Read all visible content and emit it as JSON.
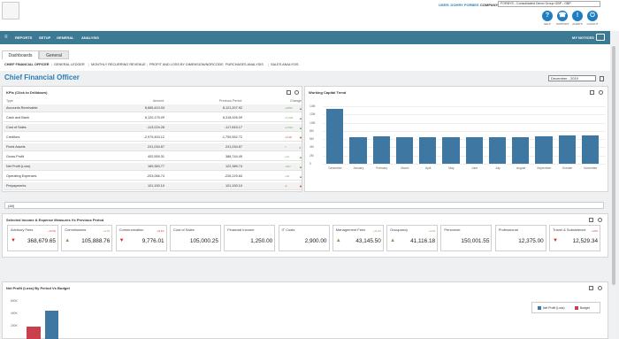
{
  "header": {
    "user": "USER: DOHRY FORBES",
    "company_label": "COMPANY:",
    "company_value": "FORBYS - Consolidated Demo Group GBP - GBP",
    "tools": [
      {
        "label": "HELP",
        "icon": "?"
      },
      {
        "label": "SUPPORT",
        "icon": "☎"
      },
      {
        "label": "ALERTS",
        "icon": "!"
      },
      {
        "label": "LOGOUT",
        "icon": "⏻"
      }
    ]
  },
  "nav": {
    "items": [
      "REPORTS",
      "SETUP",
      "GENERAL",
      "ANALYSIS"
    ],
    "notices": "MY NOTICES"
  },
  "subnav": [
    "CHIEF FINANCIAL OFFICER",
    "GENERAL LEDGER",
    "MONTHLY RECURRING REVENUE",
    "PROFIT AND LOSS BY DIMENSION/NORCODE",
    "PURCHASES ANALYSIS",
    "SALES ANALYSIS"
  ],
  "tabs": [
    "Dashboards",
    "General"
  ],
  "page_title": "Chief Financial Officer",
  "period": "December - 2019",
  "kpi": {
    "title": "KPIs (Click to Drilldown)",
    "cols": [
      "Type",
      "Amount",
      "Previous Period",
      "Change"
    ],
    "rows": [
      {
        "type": "Accounts Receivable",
        "amount": "8,665,410.04",
        "prev": "8,121,207.92",
        "change": "+2050",
        "dir": "up"
      },
      {
        "type": "Cash and Bank",
        "amount": "6,120,175.09",
        "prev": "6,318,926.09",
        "change": "+1,226",
        "dir": "up"
      },
      {
        "type": "Cost of Sales",
        "amount": "-113,224.28",
        "prev": "-117,843.17",
        "change": "+4,614",
        "dir": "up"
      },
      {
        "type": "Creditors",
        "amount": "-2,979,453.12",
        "prev": "-1,759,552.72",
        "change": "-1719",
        "dir": "down"
      },
      {
        "type": "Fixed Assets",
        "amount": "241,034.67",
        "prev": "241,034.67",
        "change": "0",
        "dir": "neutral"
      },
      {
        "type": "Gross Profit",
        "amount": "402,559.31",
        "prev": "388,744.49",
        "change": "+14",
        "dir": "up"
      },
      {
        "type": "Net Profit (Loss)",
        "amount": "189,383.77",
        "prev": "122,389.74",
        "change": "+107",
        "dir": "up"
      },
      {
        "type": "Operating Expenses",
        "amount": "-203,066.74",
        "prev": "-226,229.84",
        "change": "+23",
        "dir": "up"
      },
      {
        "type": "Prepayments",
        "amount": "101,150.10",
        "prev": "101,150.10",
        "change": "-1",
        "dir": "down"
      }
    ]
  },
  "wc": {
    "title": "Working Capital Trend",
    "months": [
      "December",
      "January",
      "February",
      "March",
      "April",
      "May",
      "June",
      "July",
      "August",
      "September",
      "October",
      "November"
    ],
    "yticks": [
      "0",
      "2M",
      "4M",
      "6M",
      "8M",
      "10M",
      "12M",
      "14M"
    ]
  },
  "chart_data": {
    "type": "bar",
    "categories": [
      "December",
      "January",
      "February",
      "March",
      "April",
      "May",
      "June",
      "July",
      "August",
      "September",
      "October",
      "November"
    ],
    "values": [
      13.3,
      6.5,
      6.6,
      6.4,
      6.5,
      6.4,
      6.5,
      6.4,
      6.5,
      6.6,
      6.8,
      6.9
    ],
    "ylim": [
      0,
      14
    ]
  },
  "kpi_dropdown": "(All)",
  "income": {
    "title": "Selected Income & Expense Measures Vs Previous Period",
    "cards": [
      {
        "name": "Advisory Fees",
        "value": "368,679.65",
        "pct": "+10.5%",
        "dir": "down"
      },
      {
        "name": "Commissions",
        "value": "105,888.76",
        "pct": "+4.7%",
        "dir": "up"
      },
      {
        "name": "Communication",
        "value": "9,776.01",
        "pct": "-24.4%",
        "dir": "down"
      },
      {
        "name": "Cost of Sales",
        "value": "105,000.25",
        "pct": "",
        "dir": "none"
      },
      {
        "name": "Financial Income",
        "value": "1,250.00",
        "pct": "",
        "dir": "none"
      },
      {
        "name": "IT Costs",
        "value": "2,900.00",
        "pct": "",
        "dir": "none"
      },
      {
        "name": "Management Fees",
        "value": "43,145.50",
        "pct": "+14.3%",
        "dir": "up"
      },
      {
        "name": "Occupancy",
        "value": "41,116.18",
        "pct": "+4.4%",
        "dir": "up"
      },
      {
        "name": "Personnel",
        "value": "150,001.55",
        "pct": "",
        "dir": "none"
      },
      {
        "name": "Professional",
        "value": "12,375.00",
        "pct": "",
        "dir": "none"
      },
      {
        "name": "Travel & Subsistence",
        "value": "12,529.34",
        "pct": "+4.5%",
        "dir": "down"
      }
    ]
  },
  "np": {
    "title": "Net Profit (Loss) By Period Vs Budget",
    "yticks": [
      "600K",
      "400K",
      "200K"
    ],
    "legend": [
      "Net Profit (Loss)",
      "Budget"
    ],
    "colors": {
      "actual": "#3e77a1",
      "budget": "#c9404c"
    }
  }
}
